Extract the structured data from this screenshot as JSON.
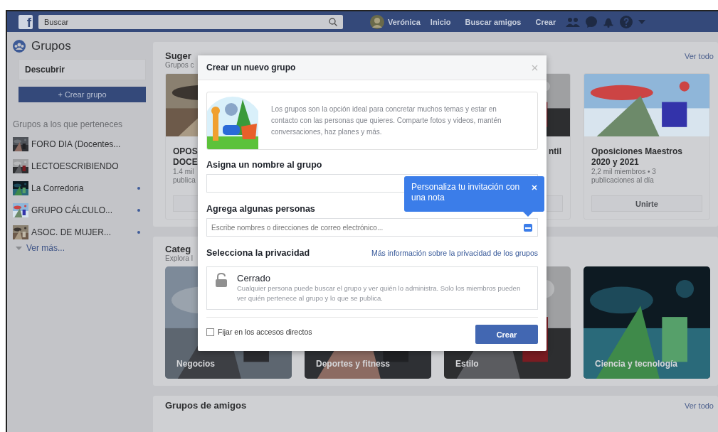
{
  "top_bar": {
    "logo": "f",
    "search": {
      "placeholder": "Buscar"
    },
    "profile_name": "Verónica",
    "nav": [
      "Inicio",
      "Buscar amigos",
      "Crear"
    ]
  },
  "sidebar": {
    "title": "Grupos",
    "discover": "Descubrir",
    "create_button": "+ Crear grupo",
    "section_title": "Grupos a los que perteneces",
    "groups": [
      {
        "name": "FORO DIA (Docentes...",
        "unread": false
      },
      {
        "name": "LECTOESCRIBIENDO",
        "unread": false
      },
      {
        "name": "La Corredoria",
        "unread": true
      },
      {
        "name": "GRUPO CÁLCULO...",
        "unread": true
      },
      {
        "name": "ASOC. DE MUJER...",
        "unread": true
      }
    ],
    "more": "Ver más..."
  },
  "suggestions": {
    "title": "Suger",
    "subtitle": "Grupos c",
    "see_all": "Ver todo",
    "cards": [
      {
        "title_lines": [
          "OPOS",
          "DOCE"
        ],
        "meta_lines": [
          "1.4 mil",
          "publica"
        ]
      },
      {
        "title_lines": [
          "ntil"
        ]
      },
      {
        "title_lines": [
          "Oposiciones Maestros",
          "2020 y 2021"
        ],
        "meta_lines": [
          "2,2 mil miembros • 3",
          "publicaciones al día"
        ],
        "button": "Unirte"
      }
    ]
  },
  "categories": {
    "title": "Categ",
    "subtitle": "Explora l",
    "tiles": [
      {
        "label": "Negocios"
      },
      {
        "label": "Deportes y fitness"
      },
      {
        "label": "Estilo"
      },
      {
        "label": "Ciencia y tecnología"
      }
    ]
  },
  "friends_groups": {
    "title": "Grupos de amigos",
    "see_all": "Ver todo"
  },
  "modal": {
    "title": "Crear un nuevo grupo",
    "intro": "Los grupos son la opción ideal para concretar muchos temas y estar en contacto con las personas que quieres. Comparte fotos y videos, mantén conversaciones, haz planes y más.",
    "name_label": "Asigna un nombre al grupo",
    "people_label": "Agrega algunas personas",
    "people_field": {
      "placeholder": "Escribe nombres o direcciones de correo electrónico..."
    },
    "tooltip": "Personaliza tu invitación con una nota",
    "privacy_label": "Selecciona la privacidad",
    "privacy_link": "Más información sobre la privacidad de los grupos",
    "privacy": {
      "name": "Cerrado",
      "description": "Cualquier persona puede buscar el grupo y ver quién lo administra. Solo los miembros pueden ver quién pertenece al grupo y lo que se publica."
    },
    "pin_shortcut": {
      "label": "Fijar en los accesos directos",
      "checked": false
    },
    "submit": "Crear"
  }
}
